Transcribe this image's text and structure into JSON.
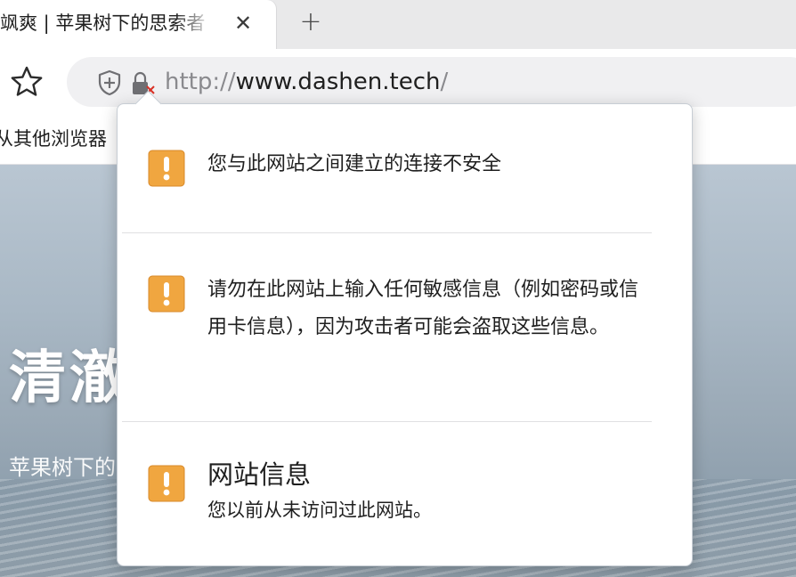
{
  "tab": {
    "title": "飒爽 | 苹果树下的思索者",
    "close_glyph": "✕"
  },
  "new_tab_glyph": "+",
  "toolbar": {
    "url": {
      "scheme": "http://",
      "host": "www.dashen.tech",
      "path": "/"
    }
  },
  "bookmarks": {
    "item": "从其他浏览器"
  },
  "page": {
    "hero_title": "清澈",
    "hero_subtitle": "苹果树下的"
  },
  "popup": {
    "connection_warning": "您与此网站之间建立的连接不安全",
    "sensitive_warning": "请勿在此网站上输入任何敏感信息（例如密码或信用卡信息），因为攻击者可能会盗取这些信息。",
    "site_info_heading": "网站信息",
    "site_info_text": "您以前从未访问过此网站。"
  },
  "icons": {
    "star": "star-icon",
    "shield": "shield-icon",
    "lock": "lock-insecure-icon",
    "warning": "warning-icon"
  },
  "colors": {
    "warning_fill": "#f0a640",
    "insecure_red": "#d93025",
    "url_dim": "#8a8a8e"
  }
}
